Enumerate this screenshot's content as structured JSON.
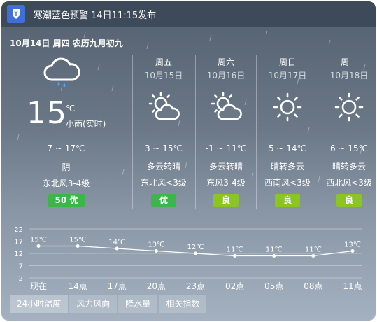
{
  "alert": {
    "text": "寒潮蓝色预警 14日11:15发布",
    "icon": "cold-wave-warning-icon",
    "icon_color": "#3f6fd8"
  },
  "date_line": "10月14日 周四 农历九月初九",
  "today": {
    "icon": "cloud-rain-icon",
    "temp": "15",
    "unit": "℃",
    "now_desc": "小雨(实时)",
    "range": "7 ~ 17℃",
    "condition": "阴",
    "wind": "东北风3-4级",
    "aqi": "50 优",
    "aqi_color": "#3cb54a"
  },
  "forecast": [
    {
      "day": "周五",
      "date": "10月15日",
      "icon": "partly-cloudy-icon",
      "range": "3 ~ 15℃",
      "condition": "多云转晴",
      "wind": "东北风<3级",
      "aqi": "优",
      "aqi_color": "#3cb54a"
    },
    {
      "day": "周六",
      "date": "10月16日",
      "icon": "partly-cloudy-icon",
      "range": "-1 ~ 11℃",
      "condition": "多云转晴",
      "wind": "东风3-4级",
      "aqi": "良",
      "aqi_color": "#8bc425"
    },
    {
      "day": "周日",
      "date": "10月17日",
      "icon": "sun-icon",
      "range": "5 ~ 14℃",
      "condition": "晴转多云",
      "wind": "西南风<3级",
      "aqi": "良",
      "aqi_color": "#8bc425"
    },
    {
      "day": "周一",
      "date": "10月18日",
      "icon": "sun-icon",
      "range": "6 ~ 15℃",
      "condition": "晴转多云",
      "wind": "西北风<3级",
      "aqi": "良",
      "aqi_color": "#8bc425"
    }
  ],
  "chart_data": {
    "type": "line",
    "title": "",
    "xlabel": "",
    "ylabel": "",
    "categories": [
      "现在",
      "14点",
      "17点",
      "20点",
      "23点",
      "02点",
      "05点",
      "08点",
      "11点"
    ],
    "series": [
      {
        "values": [
          15,
          15,
          14,
          13,
          12,
          11,
          11,
          11,
          13
        ]
      }
    ],
    "point_labels": [
      "15℃",
      "15℃",
      "14℃",
      "13℃",
      "12℃",
      "11℃",
      "11℃",
      "11℃",
      "13℃"
    ],
    "y_ticks": [
      22,
      17,
      12,
      7,
      2
    ],
    "ylim": [
      2,
      22
    ],
    "grid": true
  },
  "tabs": [
    {
      "label": "24小时温度",
      "active": true
    },
    {
      "label": "风力风向",
      "active": false
    },
    {
      "label": "降水量",
      "active": false
    },
    {
      "label": "相关指数",
      "active": false
    }
  ]
}
